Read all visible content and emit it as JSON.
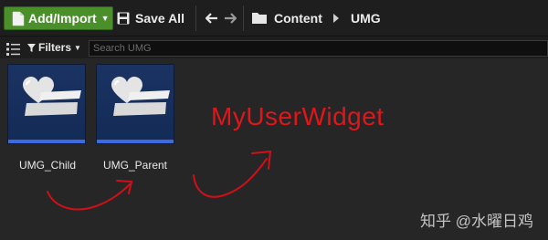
{
  "toolbar": {
    "add_import_label": "Add/Import",
    "save_all_label": "Save All",
    "breadcrumb": [
      "Content",
      "UMG"
    ]
  },
  "filters": {
    "filters_label": "Filters",
    "search_placeholder": "Search UMG"
  },
  "assets": [
    {
      "name": "UMG_Child"
    },
    {
      "name": "UMG_Parent"
    }
  ],
  "annotation": {
    "text": "MyUserWidget"
  },
  "watermark": {
    "text": "知乎 @水曜日鸡"
  },
  "colors": {
    "add_button": "#4a8f2a",
    "tile_bg": "#152a52",
    "tile_bar": "#3c6ae0",
    "annotation": "#e0161b"
  },
  "icons": [
    "document-icon",
    "save-icon",
    "back-arrow-icon",
    "forward-arrow-icon",
    "folder-icon",
    "view-options-icon",
    "filter-funnel-icon",
    "widget-blueprint-icon"
  ]
}
